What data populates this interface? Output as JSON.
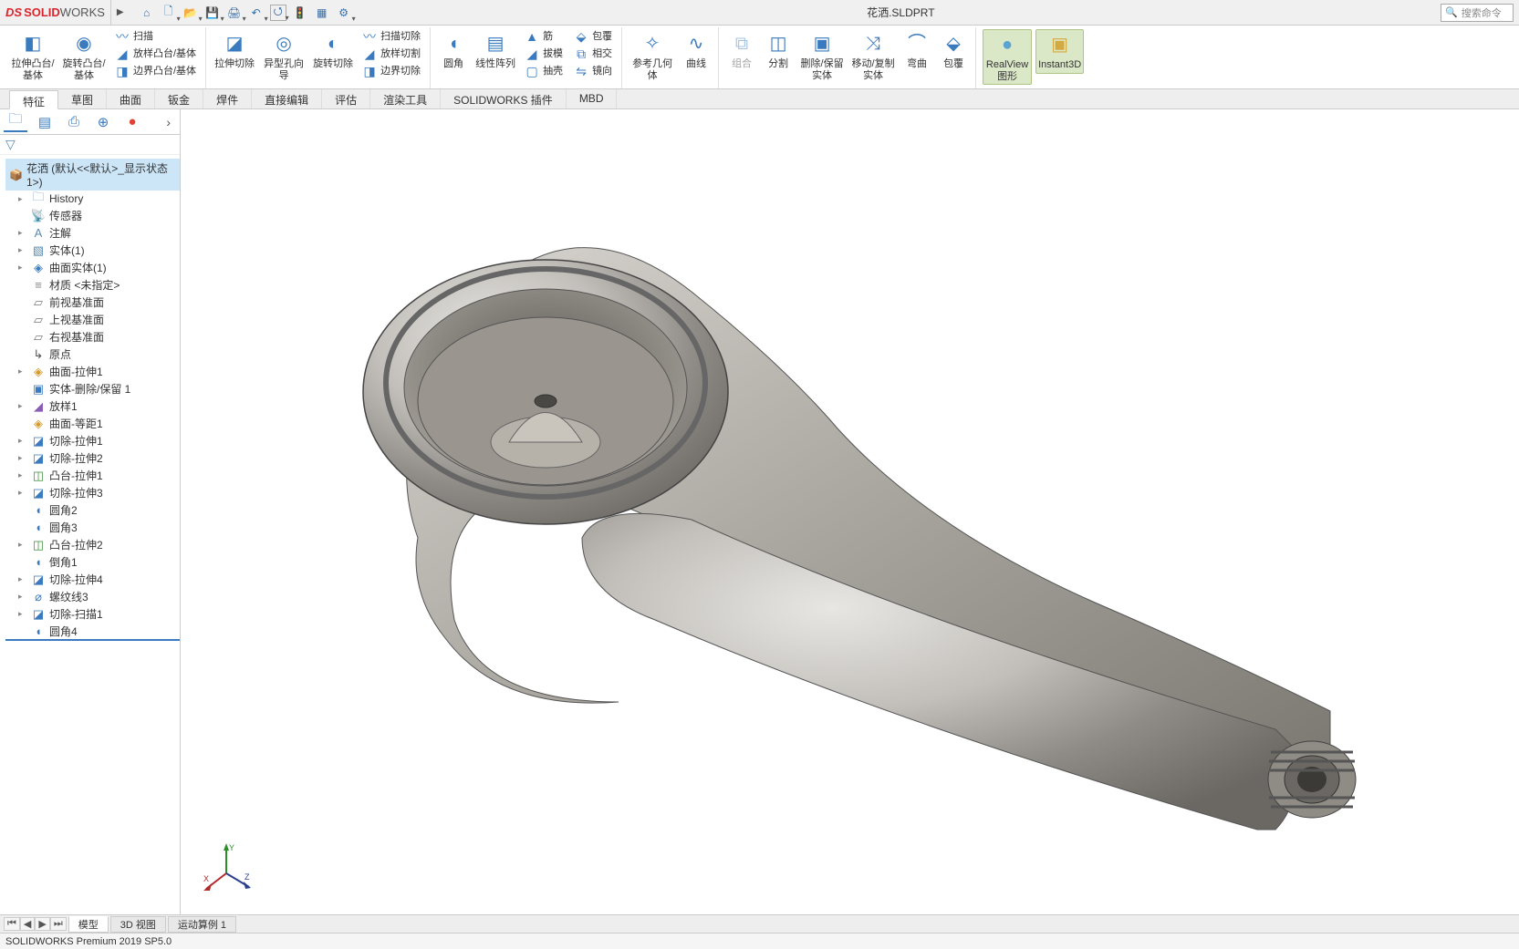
{
  "app": {
    "logo_ds": "DS",
    "logo_solid": "SOLID",
    "logo_works": "WORKS",
    "doc_title": "花洒.SLDPRT",
    "search_placeholder": "搜索命令"
  },
  "qat": [
    "home",
    "new",
    "open",
    "save",
    "print",
    "undo",
    "select",
    "stop",
    "rebuild",
    "options"
  ],
  "ribbon": {
    "g1": {
      "boss_ext": "拉伸凸台/基体",
      "boss_rev": "旋转凸台/基体",
      "sweep": "扫描",
      "loft": "放样凸台/基体",
      "boundary": "边界凸台/基体"
    },
    "g2": {
      "cut_ext": "拉伸切除",
      "hole": "异型孔向导",
      "cut_rev": "旋转切除",
      "sweep_cut": "扫描切除",
      "loft_cut": "放样切割",
      "boundary_cut": "边界切除"
    },
    "g3": {
      "fillet": "圆角",
      "linpat": "线性阵列",
      "rib": "筋",
      "draft": "拔模",
      "shell": "抽壳",
      "wrap": "包覆",
      "intersect": "相交",
      "mirror": "镜向"
    },
    "g4": {
      "refgeo": "参考几何体",
      "curve": "曲线"
    },
    "g5": {
      "combine": "组合",
      "split": "分割",
      "delkeep": "删除/保留实体",
      "movecopy": "移动/复制实体",
      "bend": "弯曲",
      "wrap2": "包覆"
    },
    "g6": {
      "realview": "RealView 图形",
      "instant3d": "Instant3D"
    }
  },
  "cmd_tabs": [
    "特征",
    "草图",
    "曲面",
    "钣金",
    "焊件",
    "直接编辑",
    "评估",
    "渲染工具",
    "SOLIDWORKS 插件",
    "MBD"
  ],
  "fp": {
    "root": "花洒  (默认<<默认>_显示状态 1>)",
    "nodes": [
      {
        "exp": "▸",
        "ic": "ic-folder",
        "t": "History"
      },
      {
        "exp": "",
        "ic": "ic-sensor",
        "t": "传感器"
      },
      {
        "exp": "▸",
        "ic": "ic-ann",
        "t": "注解"
      },
      {
        "exp": "▸",
        "ic": "ic-cube",
        "t": "实体(1)"
      },
      {
        "exp": "▸",
        "ic": "ic-surf",
        "t": "曲面实体(1)"
      },
      {
        "exp": "",
        "ic": "ic-mat",
        "t": "材质 <未指定>"
      },
      {
        "exp": "",
        "ic": "ic-plane",
        "t": "前视基准面"
      },
      {
        "exp": "",
        "ic": "ic-plane",
        "t": "上视基准面"
      },
      {
        "exp": "",
        "ic": "ic-plane",
        "t": "右视基准面"
      },
      {
        "exp": "",
        "ic": "ic-origin",
        "t": "原点"
      },
      {
        "exp": "▸",
        "ic": "ic-feat-surf",
        "t": "曲面-拉伸1"
      },
      {
        "exp": "",
        "ic": "ic-feat-body",
        "t": "实体-删除/保留 1"
      },
      {
        "exp": "▸",
        "ic": "ic-feat-loft",
        "t": "放样1"
      },
      {
        "exp": "",
        "ic": "ic-feat-surf",
        "t": "曲面-等距1"
      },
      {
        "exp": "▸",
        "ic": "ic-feat-cut",
        "t": "切除-拉伸1"
      },
      {
        "exp": "▸",
        "ic": "ic-feat-cut",
        "t": "切除-拉伸2"
      },
      {
        "exp": "▸",
        "ic": "ic-feat-ext",
        "t": "凸台-拉伸1"
      },
      {
        "exp": "▸",
        "ic": "ic-feat-cut",
        "t": "切除-拉伸3"
      },
      {
        "exp": "",
        "ic": "ic-feat-fillet",
        "t": "圆角2"
      },
      {
        "exp": "",
        "ic": "ic-feat-fillet",
        "t": "圆角3"
      },
      {
        "exp": "▸",
        "ic": "ic-feat-ext",
        "t": "凸台-拉伸2"
      },
      {
        "exp": "",
        "ic": "ic-feat-fillet",
        "t": "倒角1"
      },
      {
        "exp": "▸",
        "ic": "ic-feat-cut",
        "t": "切除-拉伸4"
      },
      {
        "exp": "▸",
        "ic": "ic-feat-thread",
        "t": "螺纹线3"
      },
      {
        "exp": "▸",
        "ic": "ic-feat-cut",
        "t": "切除-扫描1"
      },
      {
        "exp": "",
        "ic": "ic-feat-fillet",
        "t": "圆角4"
      }
    ]
  },
  "bot_tabs": {
    "model": "模型",
    "view3d": "3D 视图",
    "motion": "运动算例 1"
  },
  "status": "SOLIDWORKS Premium 2019 SP5.0",
  "triad": {
    "x": "X",
    "y": "Y",
    "z": "Z"
  }
}
